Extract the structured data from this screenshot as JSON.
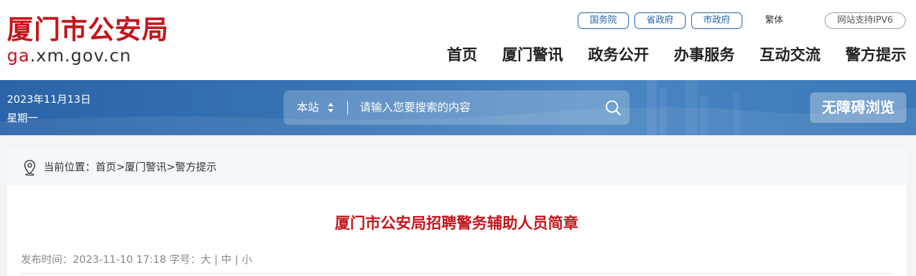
{
  "site": {
    "name": "厦门市公安局",
    "url_prefix": "ga",
    "url_rest": ".xm.gov.cn"
  },
  "top_links": [
    "国务院",
    "省政府",
    "市政府"
  ],
  "traditional": "繁体",
  "ipv6": "网站支持IPV6",
  "nav": [
    "首页",
    "厦门警讯",
    "政务公开",
    "办事服务",
    "互动交流",
    "警方提示"
  ],
  "banner": {
    "date": "2023年11月13日",
    "weekday": "星期一",
    "search_scope": "本站",
    "search_placeholder": "请输入您要搜索的内容",
    "accessibility": "无障碍浏览"
  },
  "breadcrumb": {
    "label": "当前位置：",
    "items": [
      "首页",
      "厦门警讯",
      "警方提示"
    ],
    "separator": ">"
  },
  "article": {
    "title": "厦门市公安局招聘警务辅助人员简章",
    "publish_label": "发布时间：",
    "publish_time": "2023-11-10 17:18",
    "font_label": "字号：",
    "font_sizes": [
      "大",
      "中",
      "小"
    ]
  },
  "colors": {
    "brand_red": "#c4161c",
    "banner_blue": "#2b64a8",
    "link_blue": "#1f5fa8"
  },
  "icons": [
    "location-pin-icon",
    "search-icon",
    "sort-arrows-icon"
  ]
}
